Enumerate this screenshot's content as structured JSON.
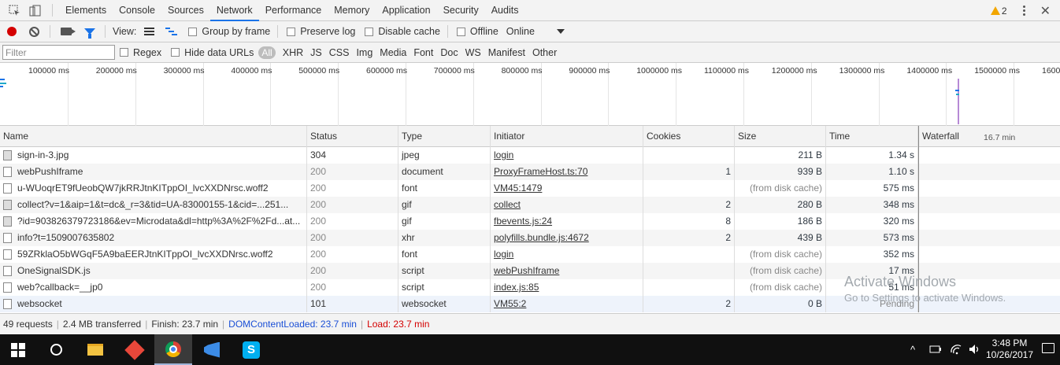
{
  "devtools_tabs": [
    "Elements",
    "Console",
    "Sources",
    "Network",
    "Performance",
    "Memory",
    "Application",
    "Security",
    "Audits"
  ],
  "active_tab": "Network",
  "warnings_count": "2",
  "toolbar": {
    "view_label": "View:",
    "group_by_frame": "Group by frame",
    "preserve_log": "Preserve log",
    "disable_cache": "Disable cache",
    "offline": "Offline",
    "throttle": "Online"
  },
  "filter": {
    "placeholder": "Filter",
    "regex": "Regex",
    "hide_data_urls": "Hide data URLs",
    "types": [
      "All",
      "XHR",
      "JS",
      "CSS",
      "Img",
      "Media",
      "Font",
      "Doc",
      "WS",
      "Manifest",
      "Other"
    ]
  },
  "overview_ticks": [
    "100000 ms",
    "200000 ms",
    "300000 ms",
    "400000 ms",
    "500000 ms",
    "600000 ms",
    "700000 ms",
    "800000 ms",
    "900000 ms",
    "1000000 ms",
    "1100000 ms",
    "1200000 ms",
    "1300000 ms",
    "1400000 ms",
    "1500000 ms",
    "160000"
  ],
  "columns": [
    "Name",
    "Status",
    "Type",
    "Initiator",
    "Cookies",
    "Size",
    "Time",
    "Waterfall"
  ],
  "waterfall_scale": "16.7 min",
  "requests": [
    {
      "name": "sign-in-3.jpg",
      "status": "304",
      "type": "jpeg",
      "initiator": "login",
      "cookies": "",
      "size": "211 B",
      "time": "1.34 s",
      "icon": "image-file-icon"
    },
    {
      "name": "webPushIframe",
      "status": "200",
      "type": "document",
      "initiator": "ProxyFrameHost.ts:70",
      "cookies": "1",
      "size": "939 B",
      "time": "1.10 s",
      "icon": "document-file-icon"
    },
    {
      "name": "u-WUoqrET9fUeobQW7jkRRJtnKITppOI_lvcXXDNrsc.woff2",
      "status": "200",
      "type": "font",
      "initiator": "VM45:1479",
      "cookies": "",
      "size": "(from disk cache)",
      "time": "575 ms",
      "icon": "font-file-icon"
    },
    {
      "name": "collect?v=1&aip=1&t=dc&_r=3&tid=UA-83000155-1&cid=...251...",
      "status": "200",
      "type": "gif",
      "initiator": "collect",
      "cookies": "2",
      "size": "280 B",
      "time": "348 ms",
      "icon": "image-file-icon"
    },
    {
      "name": "?id=903826379723186&ev=Microdata&dl=http%3A%2F%2Fd...at...",
      "status": "200",
      "type": "gif",
      "initiator": "fbevents.js:24",
      "cookies": "8",
      "size": "186 B",
      "time": "320 ms",
      "icon": "image-file-icon"
    },
    {
      "name": "info?t=1509007635802",
      "status": "200",
      "type": "xhr",
      "initiator": "polyfills.bundle.js:4672",
      "cookies": "2",
      "size": "439 B",
      "time": "573 ms",
      "icon": "xhr-file-icon"
    },
    {
      "name": "59ZRklaO5bWGqF5A9baEERJtnKITppOI_lvcXXDNrsc.woff2",
      "status": "200",
      "type": "font",
      "initiator": "login",
      "cookies": "",
      "size": "(from disk cache)",
      "time": "352 ms",
      "icon": "font-file-icon"
    },
    {
      "name": "OneSignalSDK.js",
      "status": "200",
      "type": "script",
      "initiator": "webPushIframe",
      "cookies": "",
      "size": "(from disk cache)",
      "time": "17 ms",
      "icon": "script-file-icon"
    },
    {
      "name": "web?callback=__jp0",
      "status": "200",
      "type": "script",
      "initiator": "index.js:85",
      "cookies": "",
      "size": "(from disk cache)",
      "time": "51 ms",
      "icon": "script-file-icon"
    },
    {
      "name": "websocket",
      "status": "101",
      "type": "websocket",
      "initiator": "VM55:2",
      "cookies": "2",
      "size": "0 B",
      "time": "Pending",
      "icon": "websocket-file-icon"
    }
  ],
  "status_bar": {
    "requests": "49 requests",
    "transferred": "2.4 MB transferred",
    "finish": "Finish: 23.7 min",
    "dom_content_loaded": "DOMContentLoaded: 23.7 min",
    "load": "Load: 23.7 min"
  },
  "watermark": {
    "line1": "Activate Windows",
    "line2": "Go to Settings to activate Windows."
  },
  "taskbar": {
    "time": "3:48 PM",
    "date": "10/26/2017"
  },
  "colors": {
    "record": "#d40000",
    "accent": "#1a73e8",
    "dcl": "#1a4fd6",
    "load": "#d40000"
  }
}
